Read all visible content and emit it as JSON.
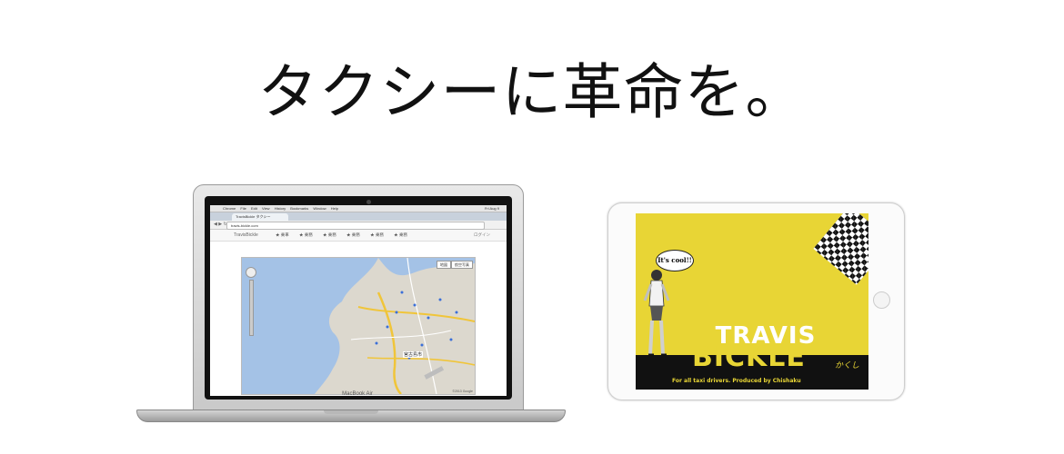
{
  "headline": "タクシーに革命を。",
  "laptop": {
    "model_label": "MacBook Air",
    "menubar": {
      "items": [
        "Chrome",
        "File",
        "Edit",
        "View",
        "History",
        "Bookmarks",
        "Window",
        "Help"
      ],
      "clock": "Fri Aug 9"
    },
    "browser": {
      "tab_title": "TravisBickle タクシー",
      "url": "travis-bickle.com"
    },
    "site": {
      "brand": "TravisBickle",
      "nav": [
        "★ 乗車",
        "★ 乗務",
        "★ 乗務",
        "★ 乗務",
        "★ 乗務",
        "★ 乗務"
      ],
      "login": "ログイン"
    },
    "map": {
      "type_buttons": [
        "地図",
        "航空写真"
      ],
      "place_label": "宮古島市",
      "credit": "©2013 Google"
    }
  },
  "tablet": {
    "speech_bubble": "It's cool!!",
    "title_line1": "TRAVIS",
    "title_line2": "BICKLE",
    "tagline": "For all taxi drivers.   Produced by Chishaku",
    "signature": "かくし"
  },
  "colors": {
    "tablet_yellow": "#e8d535",
    "band_black": "#111111",
    "map_land": "#dcd8ce",
    "map_sea": "#a4c2e6",
    "map_road": "#f0c53a"
  }
}
